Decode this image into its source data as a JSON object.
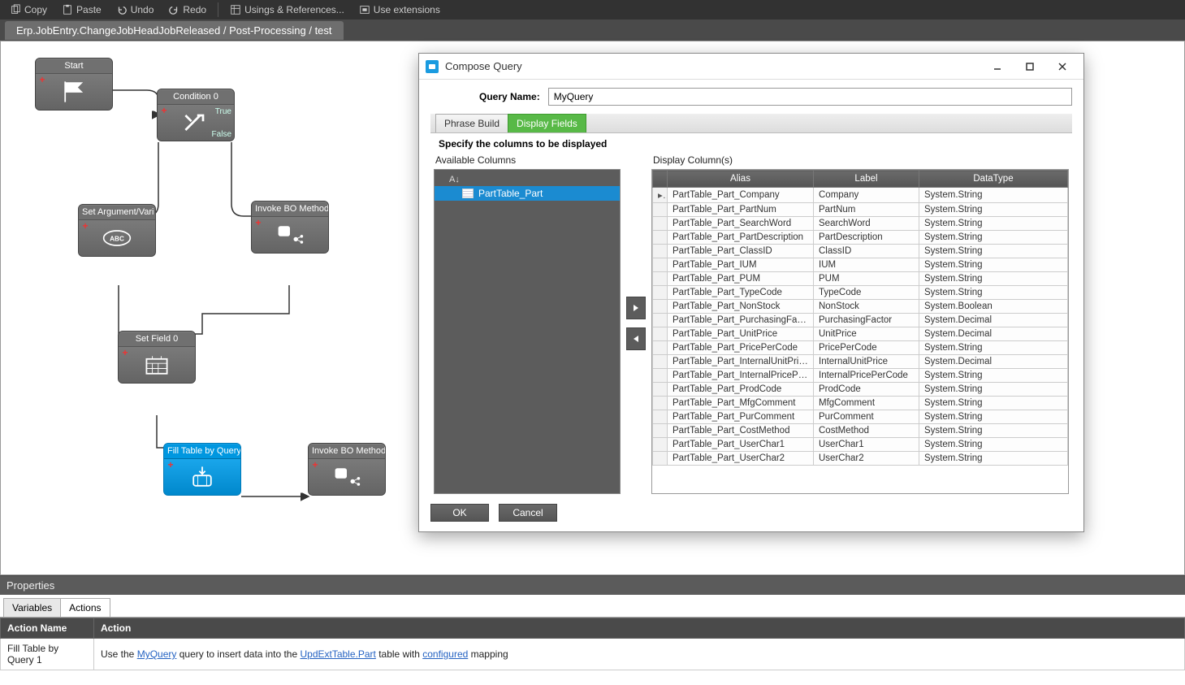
{
  "toolbar": {
    "copy": "Copy",
    "paste": "Paste",
    "undo": "Undo",
    "redo": "Redo",
    "usings": "Usings & References...",
    "extensions": "Use extensions"
  },
  "breadcrumb": "Erp.JobEntry.ChangeJobHeadJobReleased / Post-Processing / test",
  "nodes": {
    "start": "Start",
    "condition": "Condition 0",
    "condition_true": "True",
    "condition_false": "False",
    "set_arg": "Set Argument/Vari",
    "invoke1": "Invoke BO Method",
    "set_field": "Set Field 0",
    "fill_table": "Fill Table by Query",
    "invoke2": "Invoke BO Method"
  },
  "props": {
    "title": "Properties",
    "tab_variables": "Variables",
    "tab_actions": "Actions",
    "col_action_name": "Action Name",
    "col_action": "Action",
    "row": {
      "name": "Fill Table by Query 1",
      "pre": "Use the ",
      "link1": "MyQuery",
      "mid1": " query to insert data into the ",
      "link2": "UpdExtTable.Part",
      "mid2": " table with ",
      "link3": "configured",
      "post": " mapping"
    }
  },
  "dialog": {
    "title": "Compose Query",
    "qname_label": "Query Name:",
    "qname_value": "MyQuery",
    "tab_phrase": "Phrase Build",
    "tab_display": "Display Fields",
    "subtitle": "Specify the columns to be displayed",
    "avail_title": "Available Columns",
    "avail_item": "PartTable_Part",
    "disp_title": "Display Column(s)",
    "th_alias": "Alias",
    "th_label": "Label",
    "th_datatype": "DataType",
    "rows": [
      {
        "alias": "PartTable_Part_Company",
        "label": "Company",
        "type": "System.String"
      },
      {
        "alias": "PartTable_Part_PartNum",
        "label": "PartNum",
        "type": "System.String"
      },
      {
        "alias": "PartTable_Part_SearchWord",
        "label": "SearchWord",
        "type": "System.String"
      },
      {
        "alias": "PartTable_Part_PartDescription",
        "label": "PartDescription",
        "type": "System.String"
      },
      {
        "alias": "PartTable_Part_ClassID",
        "label": "ClassID",
        "type": "System.String"
      },
      {
        "alias": "PartTable_Part_IUM",
        "label": "IUM",
        "type": "System.String"
      },
      {
        "alias": "PartTable_Part_PUM",
        "label": "PUM",
        "type": "System.String"
      },
      {
        "alias": "PartTable_Part_TypeCode",
        "label": "TypeCode",
        "type": "System.String"
      },
      {
        "alias": "PartTable_Part_NonStock",
        "label": "NonStock",
        "type": "System.Boolean"
      },
      {
        "alias": "PartTable_Part_PurchasingFactor",
        "label": "PurchasingFactor",
        "type": "System.Decimal"
      },
      {
        "alias": "PartTable_Part_UnitPrice",
        "label": "UnitPrice",
        "type": "System.Decimal"
      },
      {
        "alias": "PartTable_Part_PricePerCode",
        "label": "PricePerCode",
        "type": "System.String"
      },
      {
        "alias": "PartTable_Part_InternalUnitPrice",
        "label": "InternalUnitPrice",
        "type": "System.Decimal"
      },
      {
        "alias": "PartTable_Part_InternalPricePerC",
        "label": "InternalPricePerCode",
        "type": "System.String"
      },
      {
        "alias": "PartTable_Part_ProdCode",
        "label": "ProdCode",
        "type": "System.String"
      },
      {
        "alias": "PartTable_Part_MfgComment",
        "label": "MfgComment",
        "type": "System.String"
      },
      {
        "alias": "PartTable_Part_PurComment",
        "label": "PurComment",
        "type": "System.String"
      },
      {
        "alias": "PartTable_Part_CostMethod",
        "label": "CostMethod",
        "type": "System.String"
      },
      {
        "alias": "PartTable_Part_UserChar1",
        "label": "UserChar1",
        "type": "System.String"
      },
      {
        "alias": "PartTable_Part_UserChar2",
        "label": "UserChar2",
        "type": "System.String"
      }
    ],
    "ok": "OK",
    "cancel": "Cancel"
  }
}
